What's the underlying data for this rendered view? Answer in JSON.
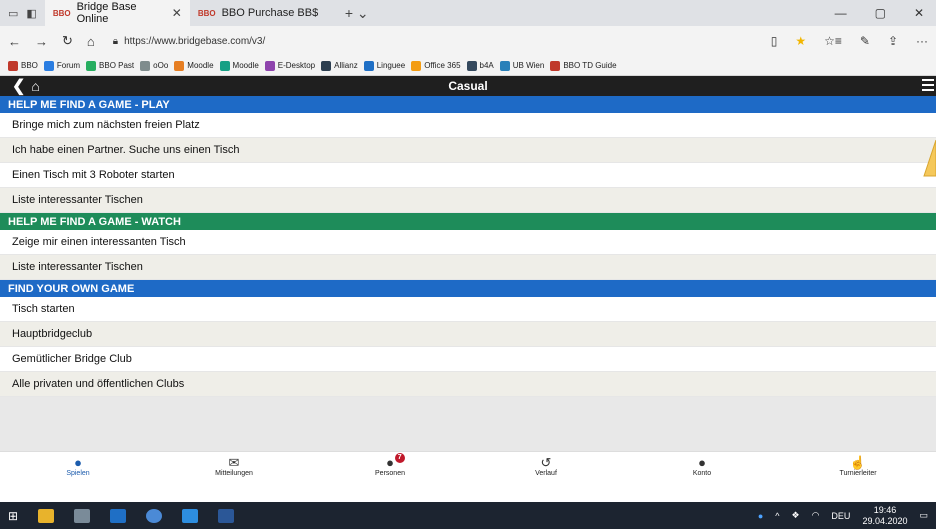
{
  "browser": {
    "tabs": [
      {
        "label": "Bridge Base Online",
        "favicon": "BBO"
      },
      {
        "label": "BBO Purchase BB$",
        "favicon": "BBO"
      }
    ],
    "url": "https://www.bridgebase.com/v3/",
    "favorites": [
      "BBO",
      "Forum",
      "BBO Past",
      "oOo",
      "Moodle",
      "Moodle",
      "E-Desktop",
      "Allianz",
      "Linguee",
      "Office 365",
      "b4A",
      "UB Wien",
      "BBO TD Guide"
    ]
  },
  "app": {
    "title": "Casual",
    "sections": [
      {
        "header": "HELP ME FIND A GAME - PLAY",
        "color": "#1e6ac6",
        "items": [
          "Bringe mich zum nächsten freien Platz",
          "Ich habe einen Partner. Suche uns einen Tisch",
          "Einen Tisch mit 3 Roboter starten",
          "Liste interessanter Tischen"
        ]
      },
      {
        "header": "HELP ME FIND A GAME - WATCH",
        "color": "#1e8c5a",
        "items": [
          "Zeige mir einen interessanten Tisch",
          "Liste interessanter Tischen"
        ]
      },
      {
        "header": "FIND YOUR OWN GAME",
        "color": "#1e6ac6",
        "items": [
          "Tisch starten",
          "Hauptbridgeclub",
          "Gemütlicher Bridge Club",
          "Alle privaten und öffentlichen Clubs"
        ]
      }
    ],
    "nav": [
      {
        "label": "Spielen",
        "icon": "play-icon",
        "active": true
      },
      {
        "label": "Mitteilungen",
        "icon": "mail-icon"
      },
      {
        "label": "Personen",
        "icon": "people-icon",
        "badge": "7"
      },
      {
        "label": "Verlauf",
        "icon": "history-icon"
      },
      {
        "label": "Konto",
        "icon": "account-icon"
      },
      {
        "label": "Turnierleiter",
        "icon": "hand-icon"
      }
    ]
  },
  "taskbar": {
    "lang": "DEU",
    "time": "19:46",
    "date": "29.04.2020"
  }
}
